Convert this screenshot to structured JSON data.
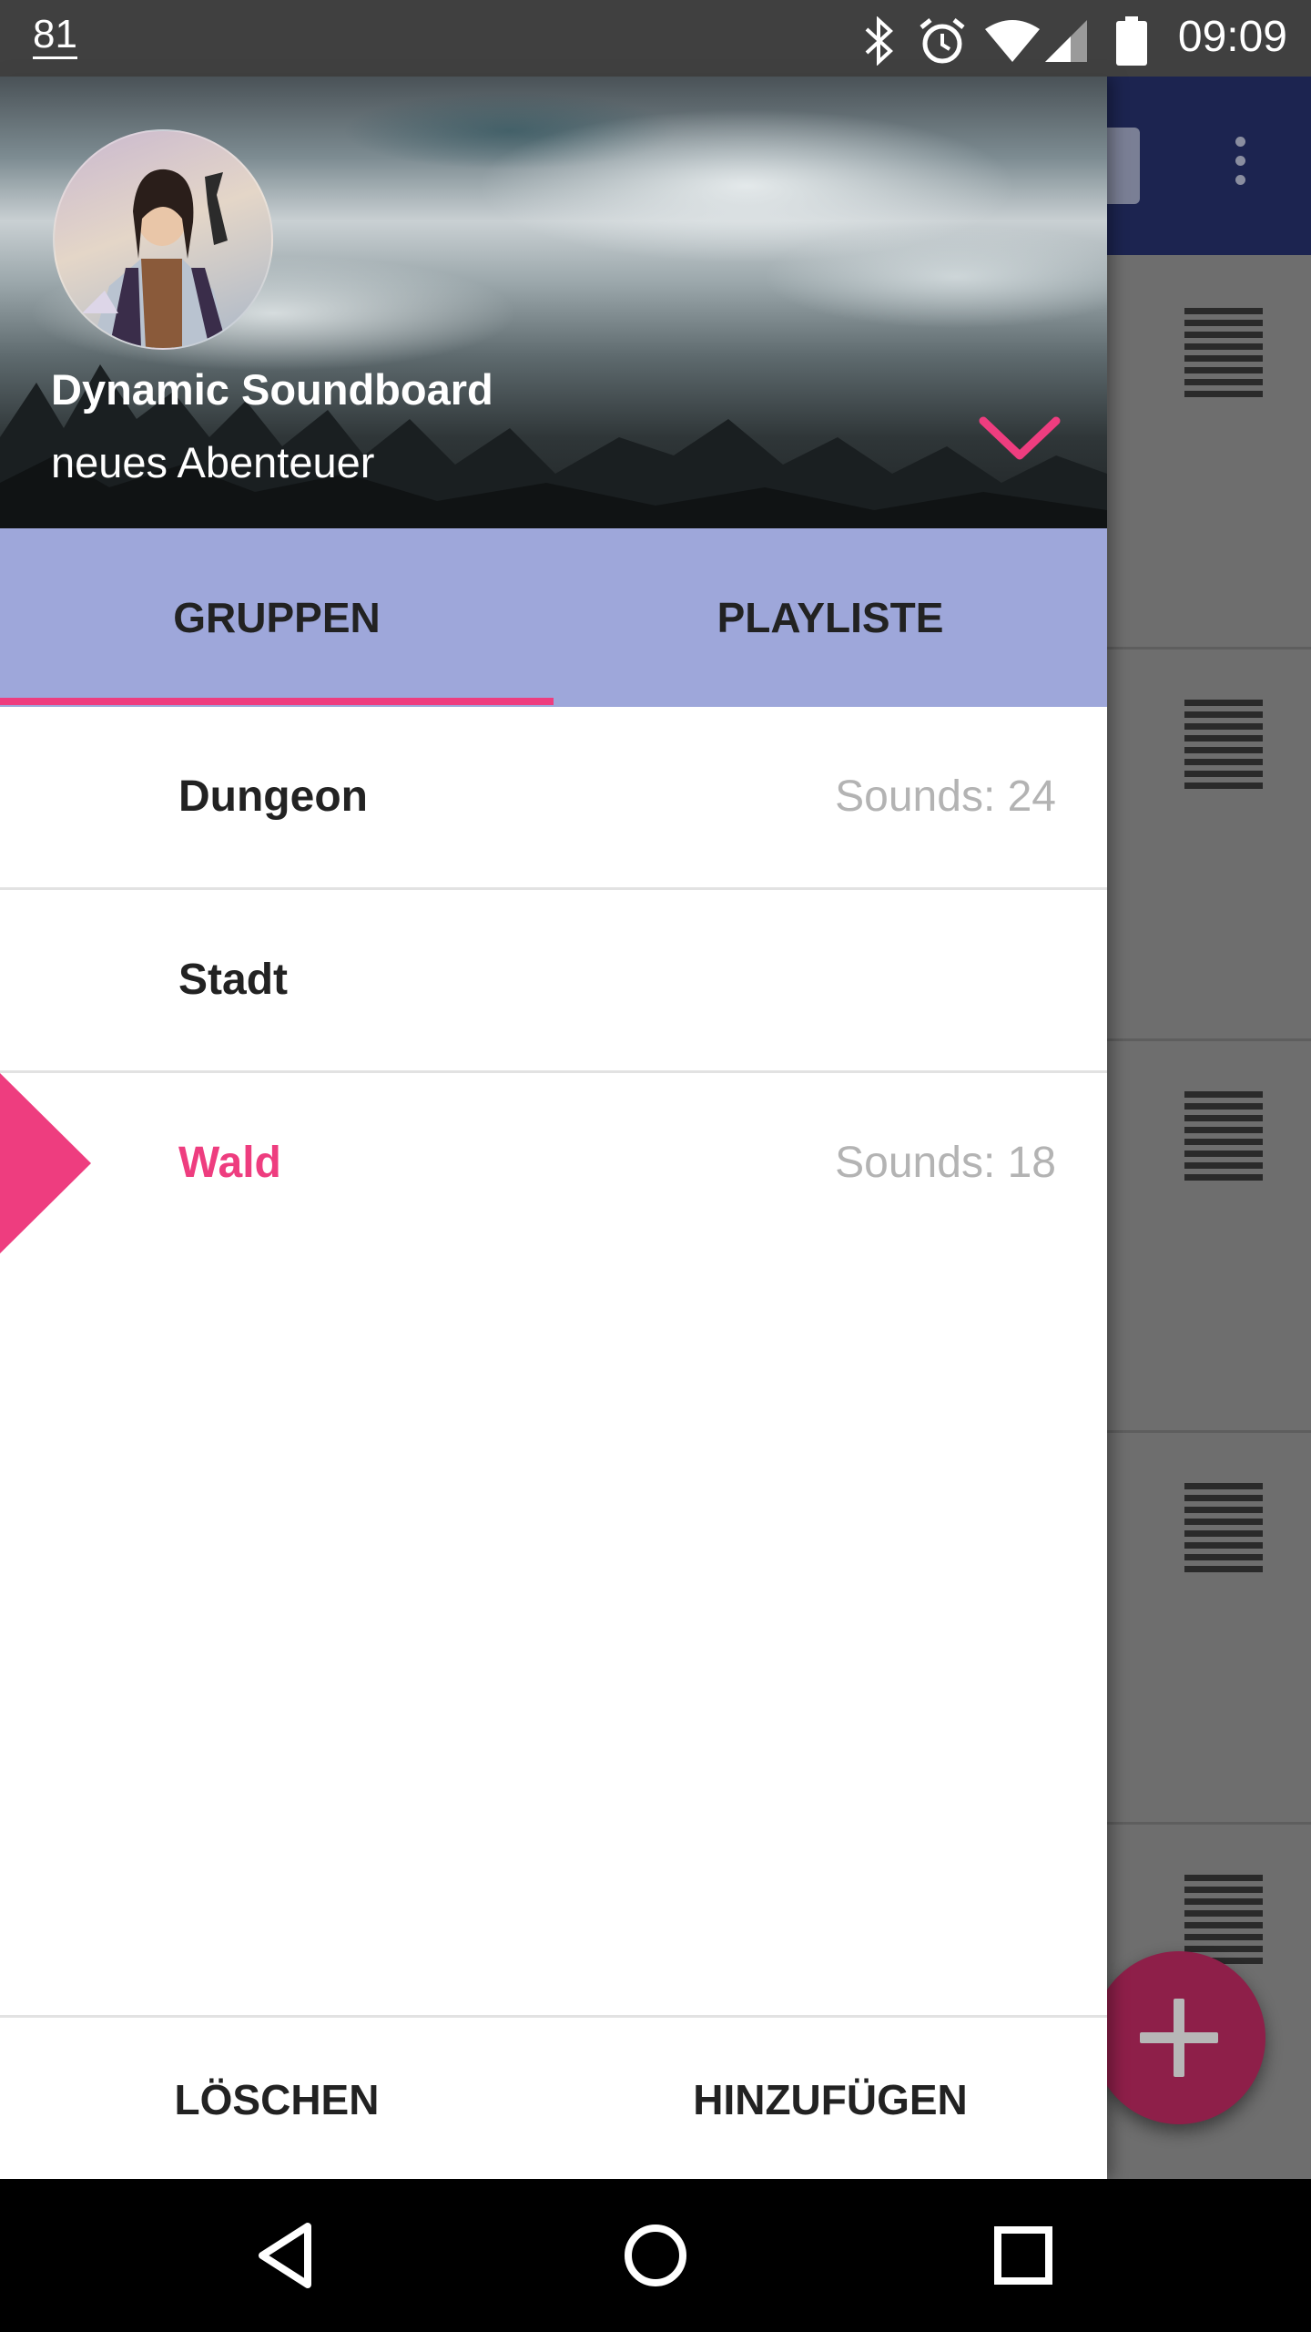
{
  "status_bar": {
    "notification_count": "81",
    "time": "09:09",
    "icons": [
      "bluetooth-icon",
      "alarm-icon",
      "wifi-icon",
      "signal-icon",
      "battery-icon"
    ]
  },
  "drawer": {
    "header": {
      "title": "Dynamic Soundboard",
      "subtitle": "neues Abenteuer"
    },
    "tabs": [
      {
        "label": "GRUPPEN",
        "selected": true
      },
      {
        "label": "PLAYLISTE",
        "selected": false
      }
    ],
    "groups": [
      {
        "name": "Dungeon",
        "count_label": "Sounds: 24",
        "selected": false
      },
      {
        "name": "Stadt",
        "count_label": "",
        "selected": false
      },
      {
        "name": "Wald",
        "count_label": "Sounds: 18",
        "selected": true
      }
    ],
    "footer": {
      "delete_label": "LÖSCHEN",
      "add_label": "HINZUFÜGEN"
    }
  },
  "colors": {
    "accent": "#ee3d7f",
    "tab_bar": "#9ea7da",
    "toolbar": "#1c2450",
    "fab": "#8e1f49"
  },
  "nav_bar": {
    "icons": [
      "back-icon",
      "home-icon",
      "recents-icon"
    ]
  }
}
